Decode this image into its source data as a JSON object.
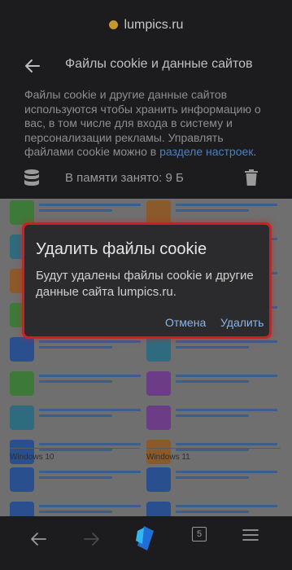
{
  "address_bar": {
    "domain": "lumpics.ru"
  },
  "settings": {
    "title": "Файлы cookie и данные сайтов",
    "description_text": "Файлы cookie и другие данные сайтов используются чтобы хранить информацию о вас, в том числе для входа в систему и персонализации рекламы. Управлять файлами cookie можно в ",
    "description_link": "разделе настроек",
    "description_end": ".",
    "memory_used": "В памяти занято: 9 Б"
  },
  "background_page": {
    "section_left": "Windows 10",
    "section_right": "Windows 11"
  },
  "dialog": {
    "title": "Удалить файлы cookie",
    "body": "Будут удалены файлы cookie и другие данные сайта lumpics.ru.",
    "cancel_label": "Отмена",
    "delete_label": "Удалить"
  },
  "bottom_nav": {
    "tab_count": "5"
  },
  "colors": {
    "highlight": "#d01f23",
    "link": "#4e7fbb",
    "dialog_button": "#8bb4e8",
    "favicon": "#c8962e"
  },
  "icons": [
    "back-arrow-icon",
    "database-icon",
    "trash-icon",
    "forward-arrow-icon",
    "browser-logo-icon",
    "tabs-icon",
    "menu-icon"
  ]
}
